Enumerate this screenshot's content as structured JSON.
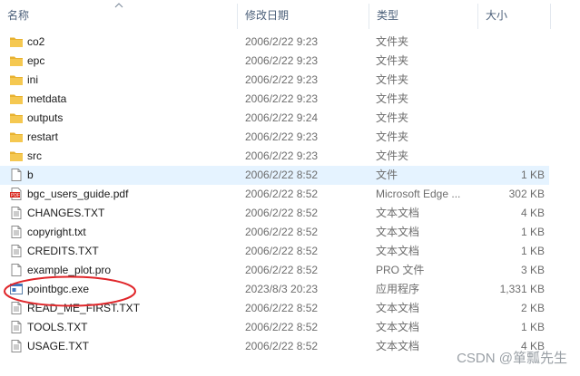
{
  "columns": {
    "name": "名称",
    "date": "修改日期",
    "type": "类型",
    "size": "大小"
  },
  "files": [
    {
      "name": "co2",
      "date": "2006/2/22 9:23",
      "type": "文件夹",
      "size": "",
      "icon": "folder-icon"
    },
    {
      "name": "epc",
      "date": "2006/2/22 9:23",
      "type": "文件夹",
      "size": "",
      "icon": "folder-icon"
    },
    {
      "name": "ini",
      "date": "2006/2/22 9:23",
      "type": "文件夹",
      "size": "",
      "icon": "folder-icon"
    },
    {
      "name": "metdata",
      "date": "2006/2/22 9:23",
      "type": "文件夹",
      "size": "",
      "icon": "folder-icon"
    },
    {
      "name": "outputs",
      "date": "2006/2/22 9:24",
      "type": "文件夹",
      "size": "",
      "icon": "folder-icon"
    },
    {
      "name": "restart",
      "date": "2006/2/22 9:23",
      "type": "文件夹",
      "size": "",
      "icon": "folder-icon"
    },
    {
      "name": "src",
      "date": "2006/2/22 9:23",
      "type": "文件夹",
      "size": "",
      "icon": "folder-icon"
    },
    {
      "name": "b",
      "date": "2006/2/22 8:52",
      "type": "文件",
      "size": "1 KB",
      "icon": "file-icon",
      "selected": true
    },
    {
      "name": "bgc_users_guide.pdf",
      "date": "2006/2/22 8:52",
      "type": "Microsoft Edge ...",
      "size": "302 KB",
      "icon": "pdf-icon"
    },
    {
      "name": "CHANGES.TXT",
      "date": "2006/2/22 8:52",
      "type": "文本文档",
      "size": "4 KB",
      "icon": "text-file-icon"
    },
    {
      "name": "copyright.txt",
      "date": "2006/2/22 8:52",
      "type": "文本文档",
      "size": "1 KB",
      "icon": "text-file-icon"
    },
    {
      "name": "CREDITS.TXT",
      "date": "2006/2/22 8:52",
      "type": "文本文档",
      "size": "1 KB",
      "icon": "text-file-icon"
    },
    {
      "name": "example_plot.pro",
      "date": "2006/2/22 8:52",
      "type": "PRO 文件",
      "size": "3 KB",
      "icon": "file-icon"
    },
    {
      "name": "pointbgc.exe",
      "date": "2023/8/3 20:23",
      "type": "应用程序",
      "size": "1,331 KB",
      "icon": "exe-icon"
    },
    {
      "name": "READ_ME_FIRST.TXT",
      "date": "2006/2/22 8:52",
      "type": "文本文档",
      "size": "2 KB",
      "icon": "text-file-icon"
    },
    {
      "name": "TOOLS.TXT",
      "date": "2006/2/22 8:52",
      "type": "文本文档",
      "size": "1 KB",
      "icon": "text-file-icon"
    },
    {
      "name": "USAGE.TXT",
      "date": "2006/2/22 8:52",
      "type": "文本文档",
      "size": "4 KB",
      "icon": "text-file-icon"
    }
  ],
  "watermark": "CSDN @箪瓢先生",
  "colors": {
    "selected_row": "#e5f3ff",
    "folder": "#f5c348",
    "annotation": "#e0262a"
  }
}
